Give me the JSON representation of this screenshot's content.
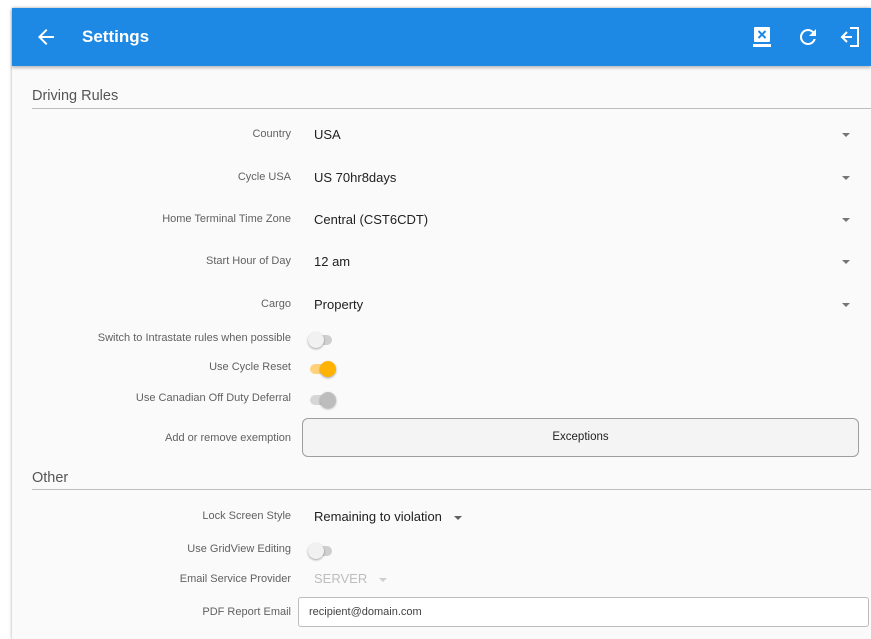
{
  "appbar": {
    "title": "Settings",
    "icons": [
      "back-arrow-icon",
      "close-log-icon",
      "refresh-icon",
      "logout-icon"
    ]
  },
  "driving_rules": {
    "section_title": "Driving Rules",
    "country": {
      "label": "Country",
      "value": "USA"
    },
    "cycle": {
      "label": "Cycle USA",
      "value": "US 70hr8days"
    },
    "time_zone": {
      "label": "Home Terminal Time Zone",
      "value": "Central (CST6CDT)"
    },
    "start_hour": {
      "label": "Start Hour of Day",
      "value": "12 am"
    },
    "cargo": {
      "label": "Cargo",
      "value": "Property"
    },
    "intrastate": {
      "label": "Switch to Intrastate rules when possible",
      "state": "off"
    },
    "cycle_reset": {
      "label": "Use Cycle Reset",
      "state": "on"
    },
    "off_duty_deferral": {
      "label": "Use Canadian Off Duty Deferral",
      "state": "disabled"
    },
    "exemption": {
      "label": "Add or remove exemption",
      "button": "Exceptions"
    }
  },
  "other": {
    "section_title": "Other",
    "lock_screen": {
      "label": "Lock Screen Style",
      "value": "Remaining to violation"
    },
    "gridview": {
      "label": "Use GridView Editing",
      "state": "off"
    },
    "email_provider": {
      "label": "Email Service Provider",
      "value": "SERVER"
    },
    "pdf_email": {
      "label": "PDF Report Email",
      "value": "recipient@domain.com"
    }
  },
  "colors": {
    "appbar": "#1e88e5",
    "toggle_on": "#ffb300"
  }
}
